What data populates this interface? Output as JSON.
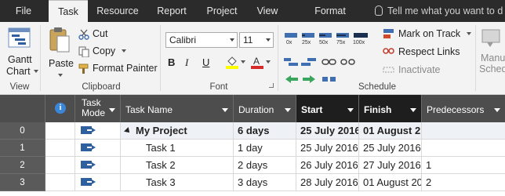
{
  "tabs": [
    {
      "label": "File",
      "active": false
    },
    {
      "label": "Task",
      "active": true
    },
    {
      "label": "Resource",
      "active": false
    },
    {
      "label": "Report",
      "active": false
    },
    {
      "label": "Project",
      "active": false
    },
    {
      "label": "View",
      "active": false
    },
    {
      "label": "Format",
      "active": false
    }
  ],
  "tell_me": "Tell me what you want to d",
  "ribbon": {
    "view_group": {
      "label": "View",
      "gantt_line1": "Gantt",
      "gantt_line2": "Chart"
    },
    "clipboard_group": {
      "label": "Clipboard",
      "paste": "Paste",
      "cut": "Cut",
      "copy": "Copy",
      "format_painter": "Format Painter"
    },
    "font_group": {
      "label": "Font",
      "font_name": "Calibri",
      "font_size": "11"
    },
    "schedule_group": {
      "label": "Schedule",
      "mark_on_track": "Mark on Track",
      "respect_links": "Respect Links",
      "inactivate": "Inactivate",
      "pct_labels": [
        "0x",
        "25x",
        "50x",
        "75x",
        "100x"
      ]
    },
    "manual_line1": "Manu",
    "manual_line2": "Sched"
  },
  "grid": {
    "headers": {
      "info": "i",
      "mode_line1": "Task",
      "mode_line2": "Mode",
      "name": "Task Name",
      "duration": "Duration",
      "start": "Start",
      "finish": "Finish",
      "predecessors": "Predecessors"
    },
    "rows": [
      {
        "num": "0",
        "name": "My Project",
        "duration": "6 days",
        "start": "25 July 2016",
        "finish": "01 August 2",
        "pred": "",
        "summary": true
      },
      {
        "num": "1",
        "name": "Task 1",
        "duration": "1 day",
        "start": "25 July 2016",
        "finish": "25 July 2016",
        "pred": "",
        "summary": false
      },
      {
        "num": "2",
        "name": "Task 2",
        "duration": "2 days",
        "start": "26 July 2016",
        "finish": "27 July 2016",
        "pred": "1",
        "summary": false
      },
      {
        "num": "3",
        "name": "Task 3",
        "duration": "3 days",
        "start": "28 July 2016",
        "finish": "01 August 20",
        "pred": "2",
        "summary": false
      }
    ]
  },
  "colors": {
    "tabbar": "#2b2b2b",
    "header": "#4d4d4d",
    "accent": "#2e5f9e",
    "active_col": "#1e1e1e"
  }
}
